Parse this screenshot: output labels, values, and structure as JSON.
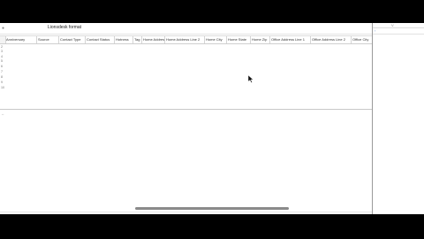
{
  "window": {
    "title": "Lionsdesk format"
  },
  "grid": {
    "columns": [
      "Anniversary",
      "Source",
      "Contact Type",
      "Contact Status",
      "Hotness",
      "Tag",
      "Home Address",
      "Home Address Line 2",
      "Home City",
      "Home State",
      "Home Zip",
      "Office Address Line 1",
      "Office Address Line 2",
      "Office City"
    ],
    "row_numbers": [
      "2",
      "3",
      "4",
      "5",
      "6",
      "7",
      "8",
      "9",
      "10"
    ]
  },
  "right_panel": {
    "label": "V",
    "marker": "‹"
  }
}
